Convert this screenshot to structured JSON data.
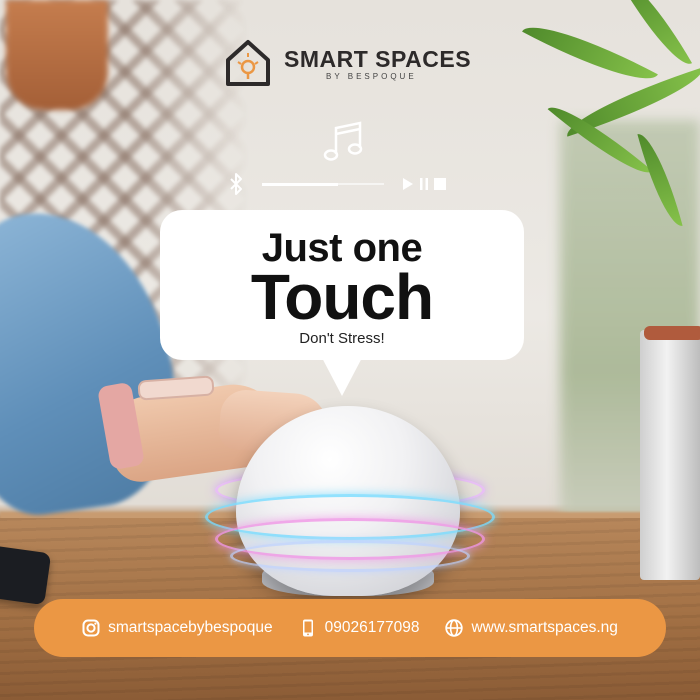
{
  "brand": {
    "name": "SMART SPACES",
    "subtitle": "BY BESPOQUE",
    "logo_icon": "house-bulb-icon"
  },
  "player": {
    "bluetooth_icon": "bluetooth-icon",
    "music_icon": "music-note-icon",
    "progress": 0.62,
    "controls": [
      "play-icon",
      "pause-icon",
      "stop-icon"
    ]
  },
  "bubble": {
    "headline_line1": "Just one",
    "headline_line2": "Touch",
    "tagline": "Don't Stress!"
  },
  "contact": {
    "instagram": "smartspacebybespoque",
    "phone": "09026177098",
    "website": "www.smartspaces.ng"
  },
  "colors": {
    "accent": "#eb9744",
    "text_dark": "#111111",
    "bubble": "#ffffff"
  }
}
